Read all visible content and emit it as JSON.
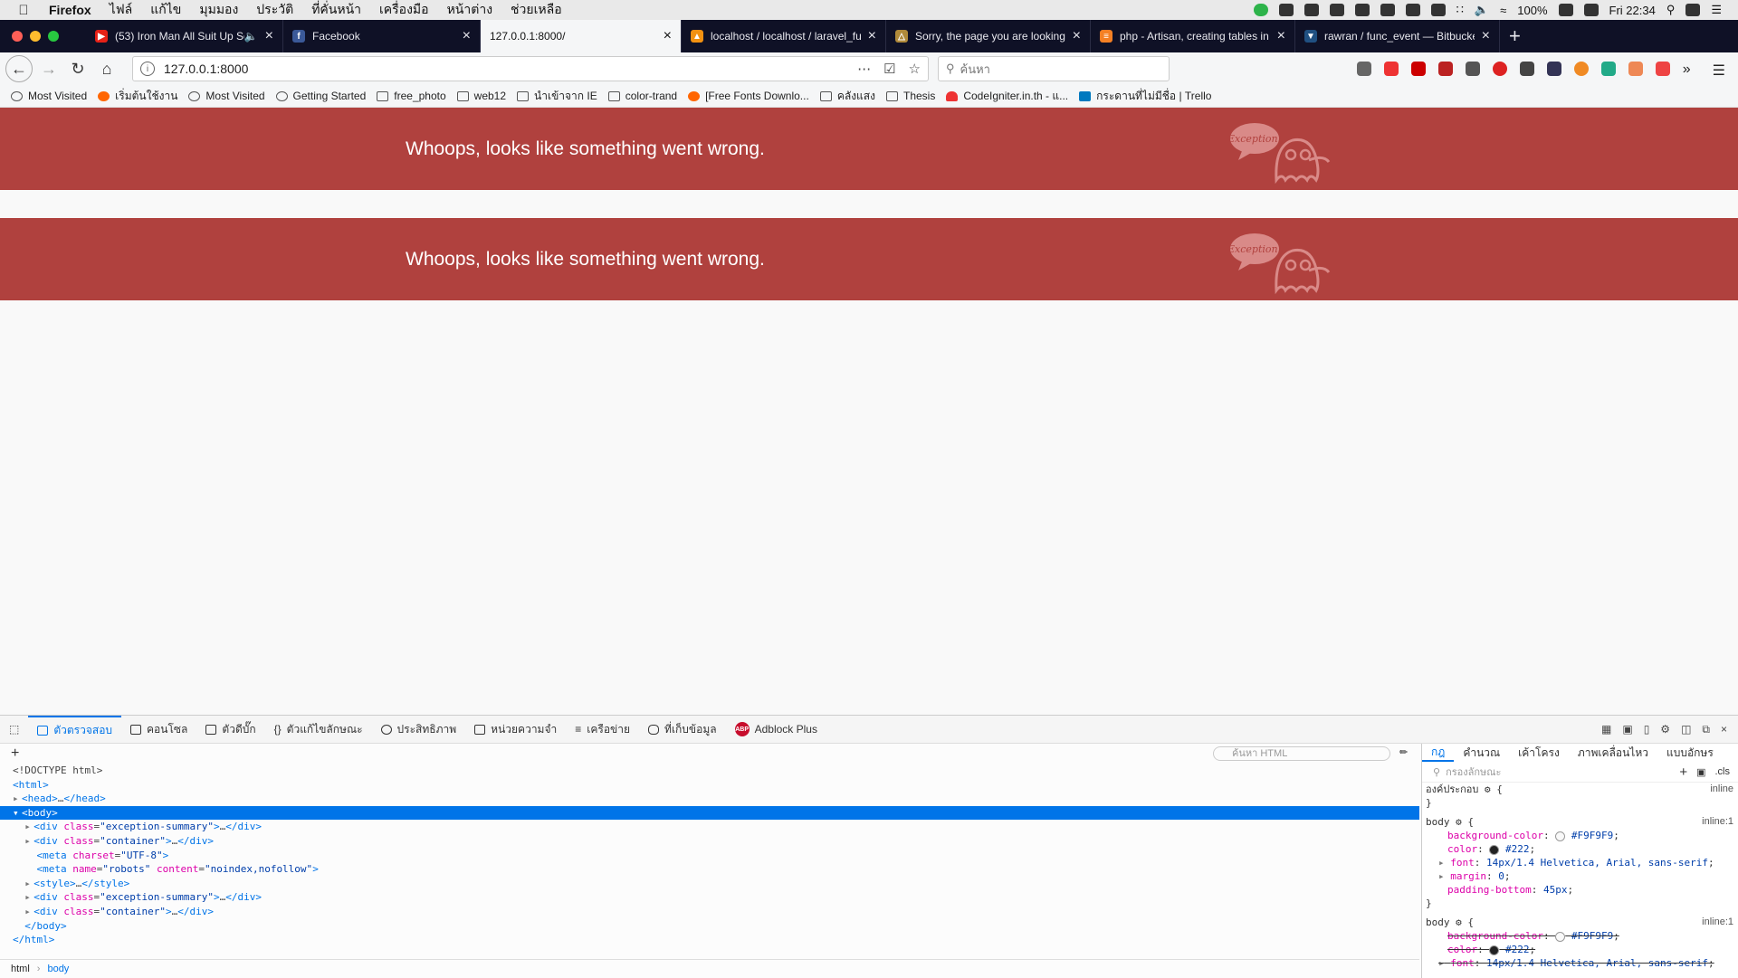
{
  "menubar": {
    "app_name": "Firefox",
    "items": [
      "ไฟล์",
      "แก้ไข",
      "มุมมอง",
      "ประวัติ",
      "ที่คั่นหน้า",
      "เครื่องมือ",
      "หน้าต่าง",
      "ช่วยเหลือ"
    ],
    "battery": "100%",
    "clock": "Fri 22:34"
  },
  "tabs": [
    {
      "title": "(53) Iron Man All Suit Up Sc",
      "favicon_color": "#e62117",
      "audio": true
    },
    {
      "title": "Facebook",
      "favicon_color": "#3b5998"
    },
    {
      "title": "127.0.0.1:8000/",
      "active": true
    },
    {
      "title": "localhost / localhost / laravel_fu",
      "favicon_color": "#f29111"
    },
    {
      "title": "Sorry, the page you are looking",
      "favicon_color": "#b08a3a"
    },
    {
      "title": "php - Artisan, creating tables in",
      "favicon_color": "#f48024"
    },
    {
      "title": "rawran / func_event — Bitbucke",
      "favicon_color": "#205081"
    }
  ],
  "navbar": {
    "url": "127.0.0.1:8000",
    "search_placeholder": "ค้นหา"
  },
  "bookmarks": [
    {
      "label": "Most Visited",
      "icon": "gear-icon"
    },
    {
      "label": "เริ่มต้นใช้งาน",
      "icon": "firefox-icon"
    },
    {
      "label": "Most Visited",
      "icon": "gear-icon"
    },
    {
      "label": "Getting Started",
      "icon": "gear-icon"
    },
    {
      "label": "free_photo",
      "icon": "folder-icon"
    },
    {
      "label": "web12",
      "icon": "folder-icon"
    },
    {
      "label": "นำเข้าจาก IE",
      "icon": "folder-icon"
    },
    {
      "label": "color-trand",
      "icon": "folder-icon"
    },
    {
      "label": "[Free Fonts Downlo...",
      "icon": "firefox-icon"
    },
    {
      "label": "คลังแสง",
      "icon": "folder-icon"
    },
    {
      "label": "Thesis",
      "icon": "folder-icon"
    },
    {
      "label": "CodeIgniter.in.th - แ...",
      "icon": "flame-icon"
    },
    {
      "label": "กระดานที่ไม่มีชื่อ | Trello",
      "icon": "trello-icon"
    }
  ],
  "page": {
    "error_message_1": "Whoops, looks like something went wrong.",
    "error_message_2": "Whoops, looks like something went wrong.",
    "ghost_label": "Exception!",
    "banner_color": "#b0413e"
  },
  "devtools": {
    "tabs": [
      "ตัวตรวจสอบ",
      "คอนโซล",
      "ตัวดีบั๊ก",
      "ตัวแก้ไขลักษณะ",
      "ประสิทธิภาพ",
      "หน่วยความจำ",
      "เครือข่าย",
      "ที่เก็บข้อมูล",
      "Adblock Plus"
    ],
    "html_search_placeholder": "ค้นหา HTML",
    "breadcrumbs": [
      "html",
      "body"
    ],
    "rules_tabs": [
      "กฎ",
      "คำนวณ",
      "เค้าโครง",
      "ภาพเคลื่อนไหว",
      "แบบอักษร"
    ],
    "filter_placeholder": "กรองลักษณะ",
    "cls_label": ".cls",
    "element_label": "องค์ประกอบ",
    "inline_label": "inline",
    "inline1_label": "inline:1",
    "rule_body": "body",
    "props": [
      {
        "name": "background-color",
        "value": "#F9F9F9"
      },
      {
        "name": "color",
        "value": "#222"
      },
      {
        "name": "font",
        "value": "14px/1.4 Helvetica, Arial, sans-serif"
      },
      {
        "name": "margin",
        "value": "0"
      },
      {
        "name": "padding-bottom",
        "value": "45px"
      }
    ]
  }
}
